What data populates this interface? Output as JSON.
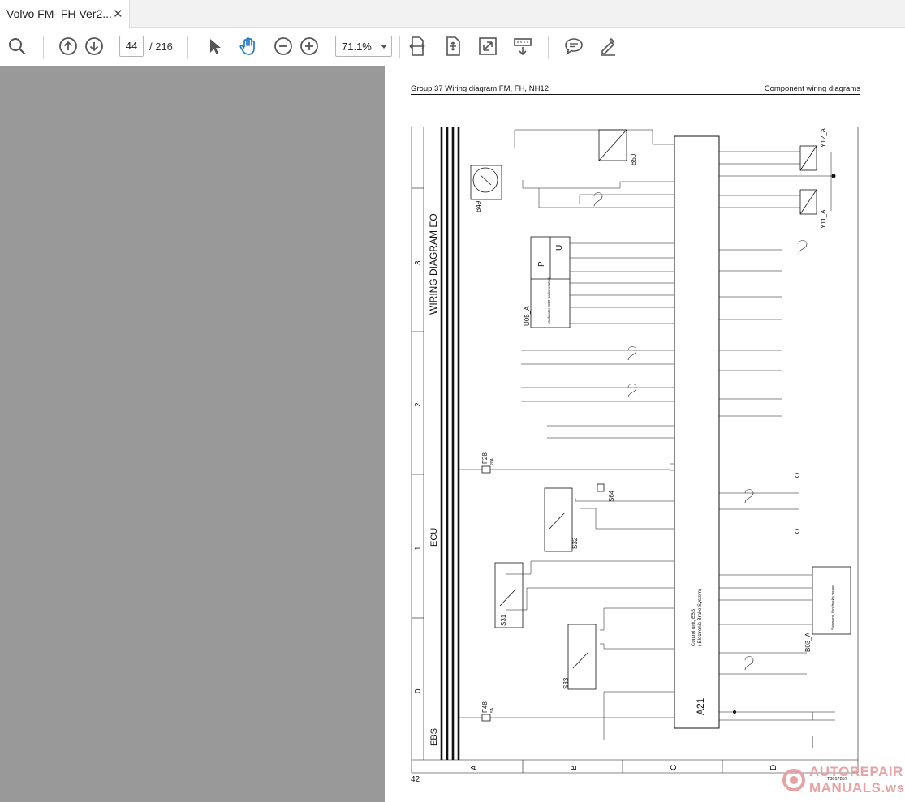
{
  "tab": {
    "title": "Volvo FM- FH Ver2...",
    "close_glyph": "✕"
  },
  "toolbar": {
    "icons": [
      "search-icon",
      "page-up-icon",
      "page-down-icon",
      "select-cursor-icon",
      "hand-tool-icon",
      "zoom-out-icon",
      "zoom-in-icon",
      "fit-width-icon",
      "fit-page-icon",
      "fullscreen-icon",
      "scroll-mode-icon",
      "comment-icon",
      "draw-icon"
    ],
    "current_page": "44",
    "total_pages": "/ 216",
    "zoom": "71.1%"
  },
  "document": {
    "header_left": "Group 37 Wiring diagram FM, FH, NH12",
    "header_right": "Component wiring diagrams",
    "page_number": "42",
    "doc_code": "T3017857",
    "watermark_line1": "AUTOREPAIR",
    "watermark_line2": "MANUALS.ws"
  },
  "diagram": {
    "title": "WIRING DIAGRAM EO",
    "bus_labels": [
      "EBS",
      "ECU"
    ],
    "grid_numbers": [
      "3",
      "2",
      "1",
      "0"
    ],
    "grid_letters": [
      "A",
      "B",
      "C",
      "D"
    ],
    "control_unit": "A21",
    "control_unit_desc1": "Control unit, EBS",
    "control_unit_desc2": "( Electronic Brake System)",
    "components": [
      {
        "id": "B49",
        "label": "B49"
      },
      {
        "id": "B50",
        "label": "B50"
      },
      {
        "id": "U05_A",
        "label": "U05_A"
      },
      {
        "id": "P",
        "label": "P"
      },
      {
        "id": "U",
        "label": "U"
      },
      {
        "id": "F28",
        "label": "F28"
      },
      {
        "id": "F28A",
        "label": "20A"
      },
      {
        "id": "S64",
        "label": "S64"
      },
      {
        "id": "S32",
        "label": "S32"
      },
      {
        "id": "S31",
        "label": "S31"
      },
      {
        "id": "S33",
        "label": "S33"
      },
      {
        "id": "F48",
        "label": "F48"
      },
      {
        "id": "F48A",
        "label": "5A"
      },
      {
        "id": "Y12_A",
        "label": "Y12_A"
      },
      {
        "id": "Y11_A",
        "label": "Y11_A"
      },
      {
        "id": "B03_A",
        "label": "B03_A"
      },
      {
        "id": "B03_desc",
        "label": "Sensors, footbrake valve"
      }
    ],
    "unit_desc": "Modulator EBS trailer control"
  }
}
